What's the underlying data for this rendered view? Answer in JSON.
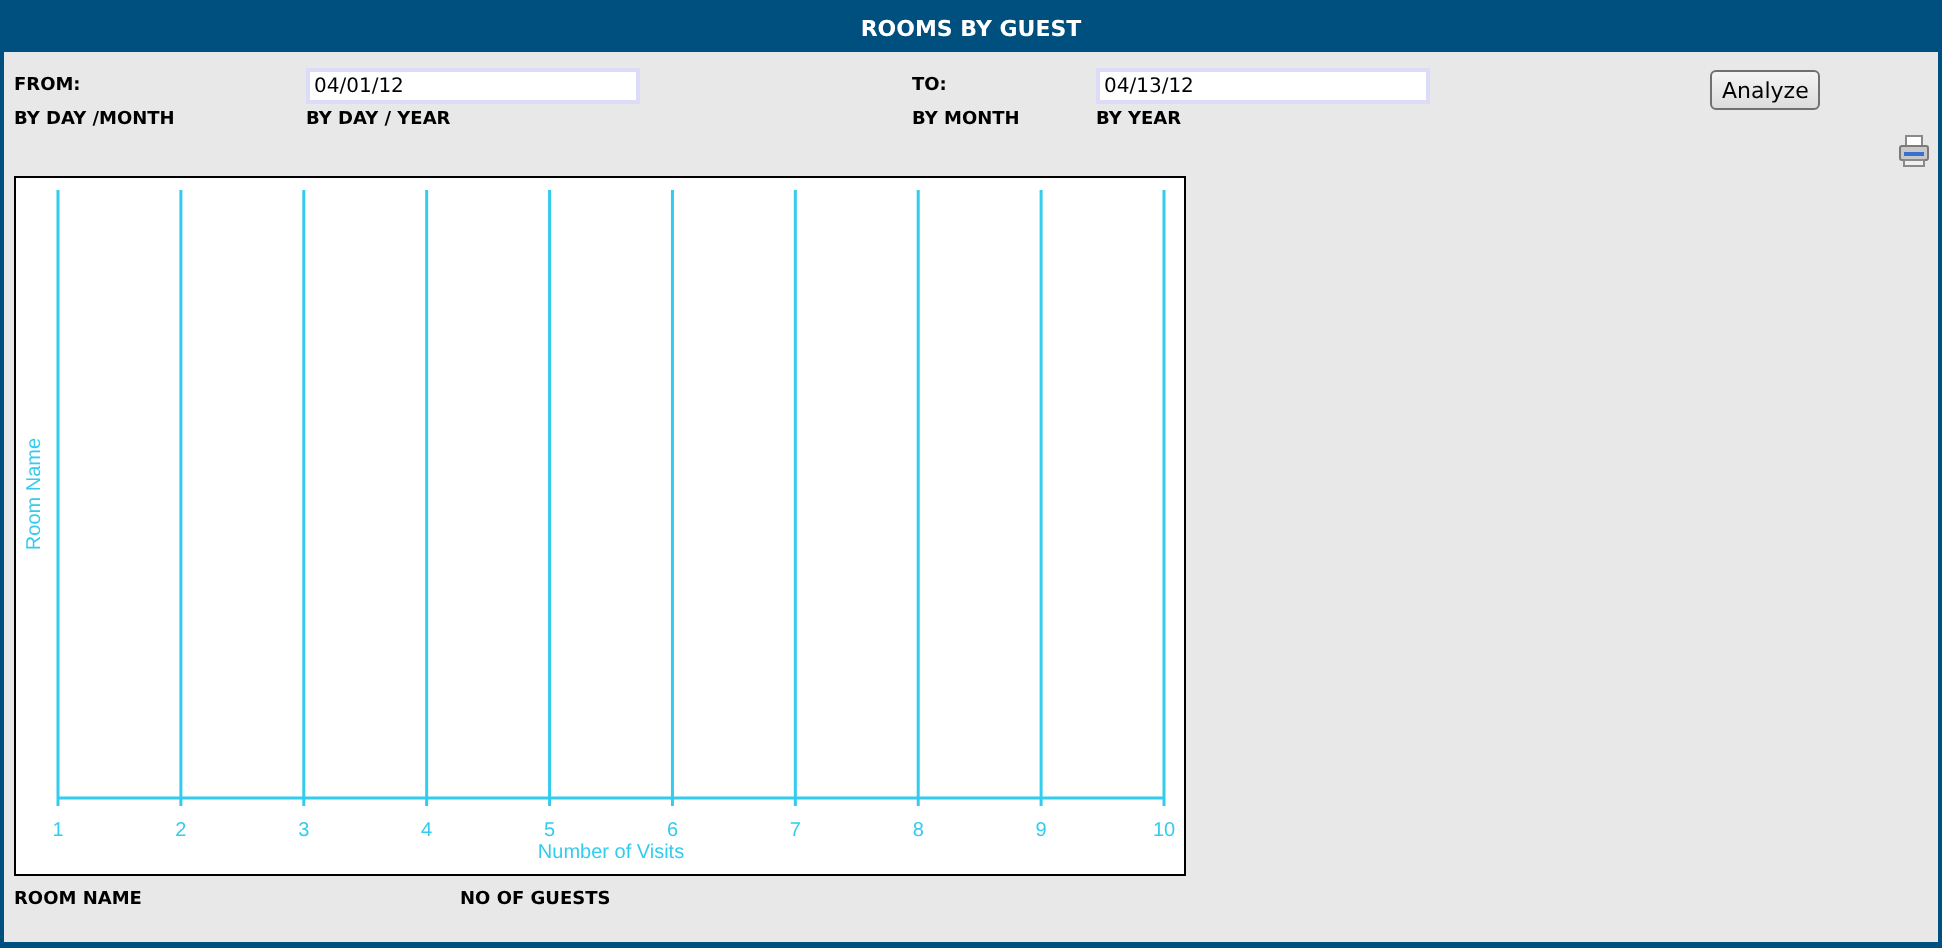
{
  "header": {
    "title": "ROOMS BY GUEST"
  },
  "filters": {
    "from_label": "FROM:",
    "from_value": "04/01/12",
    "to_label": "TO:",
    "to_value": "04/13/12",
    "analyze_button": "Analyze"
  },
  "group_options": [
    "BY DAY /MONTH",
    "BY DAY / YEAR",
    "BY MONTH",
    "BY YEAR"
  ],
  "chart_data": {
    "type": "bar",
    "orientation": "horizontal",
    "grid": true,
    "categories": [
      null
    ],
    "values": [
      null
    ],
    "xlabel": "Number of Visits",
    "ylabel": "Room Name",
    "xlim": [
      1,
      10
    ],
    "xticks": [
      1,
      2,
      3,
      4,
      5,
      6,
      7,
      8,
      9,
      10
    ]
  },
  "table": {
    "columns": [
      "ROOM NAME",
      "NO OF GUESTS"
    ]
  }
}
